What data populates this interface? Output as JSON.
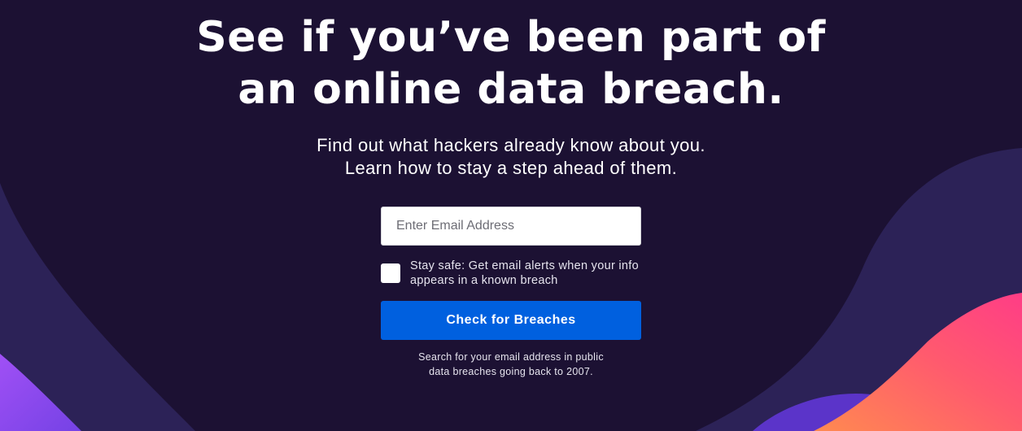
{
  "hero": {
    "headline_line1": "See if you’ve been part of",
    "headline_line2": "an online data breach.",
    "subhead_line1": "Find out what hackers already know about you.",
    "subhead_line2": "Learn how to stay a step ahead of them."
  },
  "form": {
    "email_placeholder": "Enter Email Address",
    "email_value": "",
    "alerts_label_line1": "Stay safe: Get email alerts when your info",
    "alerts_label_line2": "appears in a known breach",
    "alerts_checked": false,
    "submit_label": "Check for Breaches",
    "fineprint_line1": "Search for your email address in public",
    "fineprint_line2": "data breaches going back to 2007."
  },
  "colors": {
    "background": "#1c1133",
    "button": "#0060df",
    "wave_dark": "#2c2257",
    "wave_purple": "#7542e5",
    "wave_pink": "#ff4f82",
    "wave_orange": "#ff8a50"
  }
}
